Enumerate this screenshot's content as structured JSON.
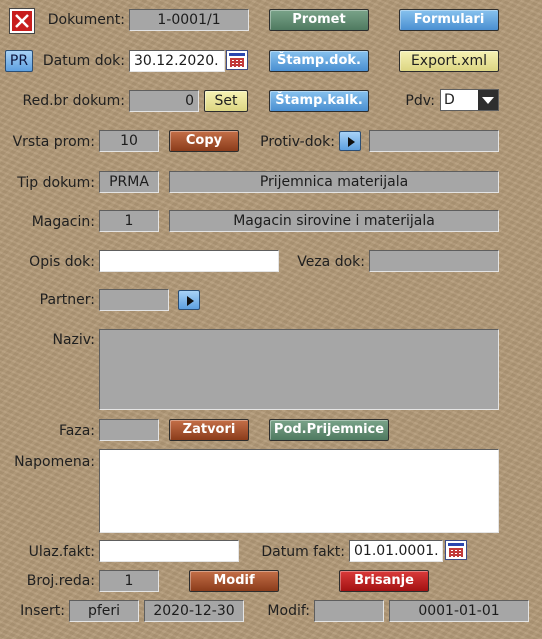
{
  "labels": {
    "dokument": "Dokument:",
    "datum_dok": "Datum dok:",
    "red_br_dokum": "Red.br dokum:",
    "pdv": "Pdv:",
    "vrsta_prom": "Vrsta prom:",
    "protiv_dok": "Protiv-dok:",
    "tip_dokum": "Tip dokum:",
    "magacin": "Magacin:",
    "opis_dok": "Opis dok:",
    "veza_dok": "Veza dok:",
    "partner": "Partner:",
    "naziv": "Naziv:",
    "faza": "Faza:",
    "napomena": "Napomena:",
    "ulaz_fakt": "Ulaz.fakt:",
    "datum_fakt": "Datum fakt:",
    "broj_reda": "Broj.reda:",
    "insert": "Insert:",
    "modif": "Modif:"
  },
  "fields": {
    "dokument": "1-0001/1",
    "datum_dok": "30.12.2020.",
    "red_br_dokum": "0",
    "pdv": "D",
    "vrsta_prom": "10",
    "protiv_dok": "",
    "tip_dokum_code": "PRMA",
    "tip_dokum_name": "Prijemnica materijala",
    "magacin_code": "1",
    "magacin_name": "Magacin sirovine i materijala",
    "opis_dok": "",
    "veza_dok": "",
    "partner": "",
    "naziv": "",
    "faza": "",
    "napomena": "",
    "ulaz_fakt": "",
    "datum_fakt": "01.01.0001.",
    "broj_reda": "1",
    "insert_user": "pferi",
    "insert_date": "2020-12-30",
    "modif_user": "",
    "modif_date": "0001-01-01"
  },
  "buttons": {
    "pr": "PR",
    "promet": "Promet",
    "formulari": "Formulari",
    "stamp_dok": "Štamp.dok.",
    "export_xml": "Export.xml",
    "set": "Set",
    "stamp_kalk": "Štamp.kalk.",
    "copy": "Copy",
    "zatvori": "Zatvori",
    "pod_prijemnice": "Pod.Prijemnice",
    "modif": "Modif",
    "brisanje": "Brisanje"
  }
}
